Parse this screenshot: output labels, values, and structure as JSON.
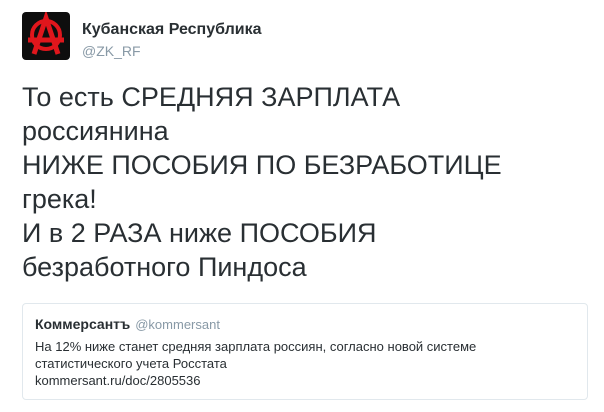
{
  "author": {
    "name": "Кубанская Республика",
    "handle": "@ZK_RF",
    "avatar_icon": "anarchy-symbol-icon",
    "avatar_color": "#e0161c"
  },
  "tweet": {
    "lines": [
      "То есть СРЕДНЯЯ ЗАРПЛАТА",
      "россиянина",
      "НИЖЕ ПОСОБИЯ ПО БЕЗРАБОТИЦЕ",
      "грека!",
      "И в 2 РАЗА ниже ПОСОБИЯ",
      "безработного Пиндоса"
    ]
  },
  "quoted_tweet": {
    "name": "Коммерсантъ",
    "handle": "@kommersant",
    "lines": [
      "На 12% ниже станет средняя зарплата россиян, согласно новой системе",
      "статистического учета Росстата",
      "kommersant.ru/doc/2805536"
    ]
  }
}
